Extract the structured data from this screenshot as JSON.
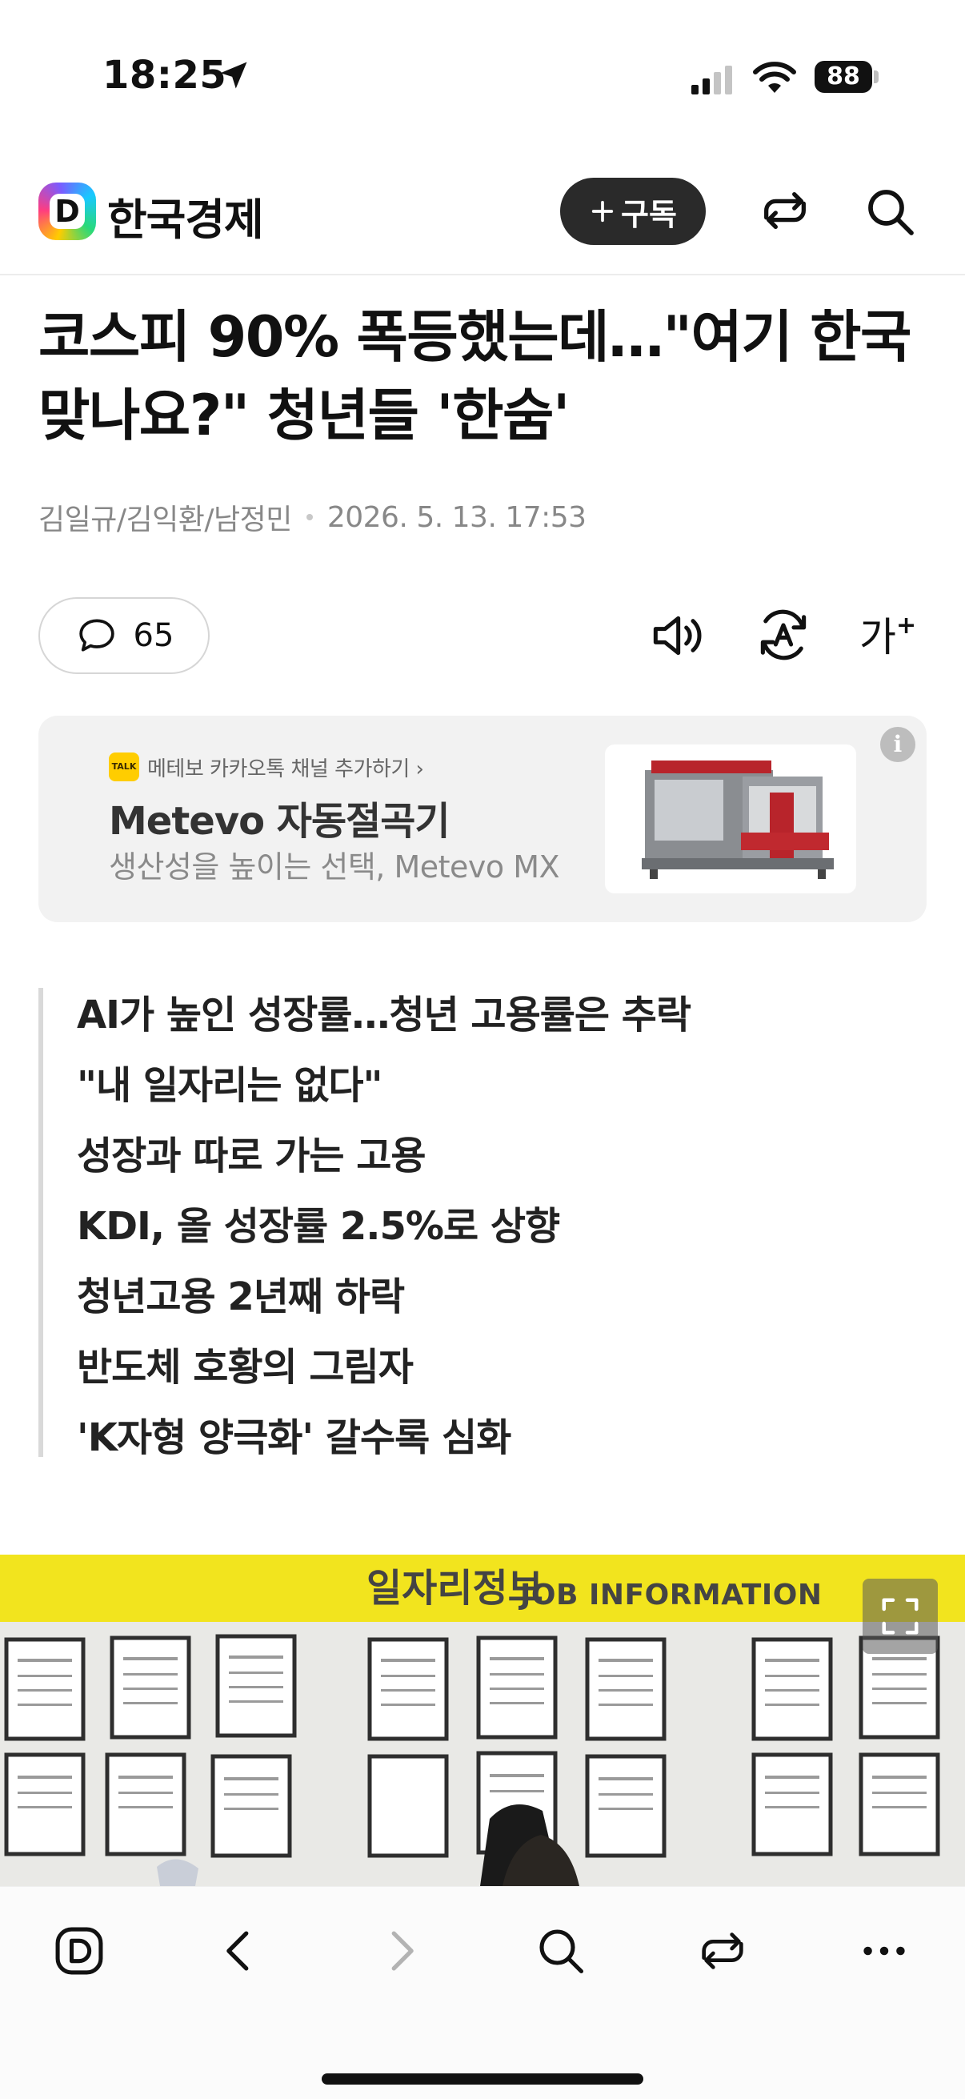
{
  "status_bar": {
    "time": "18:25",
    "battery": "88"
  },
  "header": {
    "publisher": "한국경제",
    "logo_letter": "D",
    "subscribe_label": "구독",
    "icons": [
      "share-icon",
      "search-icon"
    ]
  },
  "article": {
    "title": "코스피 90% 폭등했는데…\"여기 한국 맞나요?\" 청년들 '한숨'",
    "authors": "김일규/김익환/남정민",
    "date": "2026. 5. 13. 17:53",
    "comment_count": "65",
    "font_size_label": "가",
    "summary": [
      "AI가 높인 성장률…청년 고용률은 추락",
      "\"내 일자리는 없다\"",
      "성장과 따로 가는 고용",
      "KDI, 올 성장률 2.5%로 상향",
      "청년고용 2년째 하락",
      "반도체 호황의 그림자",
      "'K자형 양극화' 갈수록 심화"
    ]
  },
  "ad": {
    "talk_badge": "TALK",
    "channel_text": "메테보 카카오톡 채널 추가하기 ›",
    "title": "Metevo 자동절곡기",
    "description": "생산성을 높이는 선택, Metevo MX",
    "info": "i"
  },
  "photo": {
    "sign_korean": "일자리정보",
    "sign_english": "JOB INFORMATION"
  },
  "toolbar": {
    "items": [
      "daum-icon",
      "back-icon",
      "forward-icon",
      "search-icon",
      "share-icon",
      "more-icon"
    ]
  },
  "colors": {
    "subscribe_bg": "#2a2a2a",
    "ad_bg": "#f2f2f2",
    "banner_yellow": "#f2e41e",
    "kakao_yellow": "#ffcd00"
  }
}
